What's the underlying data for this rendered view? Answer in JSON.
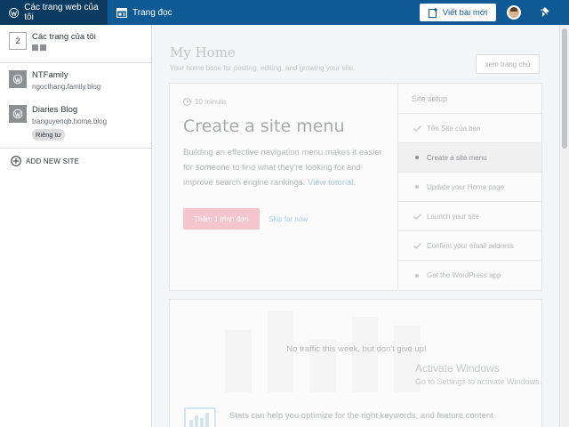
{
  "topbar": {
    "my_sites_label": "Các trang web của tôi",
    "reader_label": "Trang đọc",
    "write_label": "Viết bài mới"
  },
  "sidebar": {
    "all_sites": {
      "icon_value": "2",
      "label": "Các trang của tôi"
    },
    "sites": [
      {
        "name": "NTFamily",
        "url": "ngocthang.family.blog"
      },
      {
        "name": "Diaries Blog",
        "url": "tranguyenqb.home.blog",
        "badge": "Riêng tư"
      }
    ],
    "add_site_label": "ADD NEW SITE"
  },
  "main": {
    "title": "My Home",
    "subtitle": "Your home base for posting, editing, and growing your site.",
    "visit_site_label": "xem trang chủ",
    "setup": {
      "time": "10 minute",
      "task_title": "Create a site menu",
      "task_desc": "Building an effective navigation menu makes it easier for someone to find what they're looking for and improve search engine rankings.",
      "task_link": "View tutorial.",
      "primary_label": "Thêm 1 trình đơn",
      "skip_label": "Skip for now",
      "heading": "Site setup",
      "steps": [
        {
          "label": "Tên Site của bạn",
          "state": "done"
        },
        {
          "label": "Create a site menu",
          "state": "active"
        },
        {
          "label": "Update your Home page",
          "state": "todo"
        },
        {
          "label": "Launch your site",
          "state": "done"
        },
        {
          "label": "Confirm your email address",
          "state": "done"
        },
        {
          "label": "Get the WordPress app",
          "state": "todo"
        }
      ]
    },
    "stats": {
      "message": "No traffic this week, but don't give up!",
      "help": "Stats can help you optimize for the right keywords, and feature content"
    }
  },
  "watermark": {
    "title": "Activate Windows",
    "subtitle": "Go to Settings to activate Windows."
  },
  "colors": {
    "topbar": "#0f5a94",
    "topbar_active": "#0b3b61",
    "accent_pink": "#f2c5cf"
  }
}
